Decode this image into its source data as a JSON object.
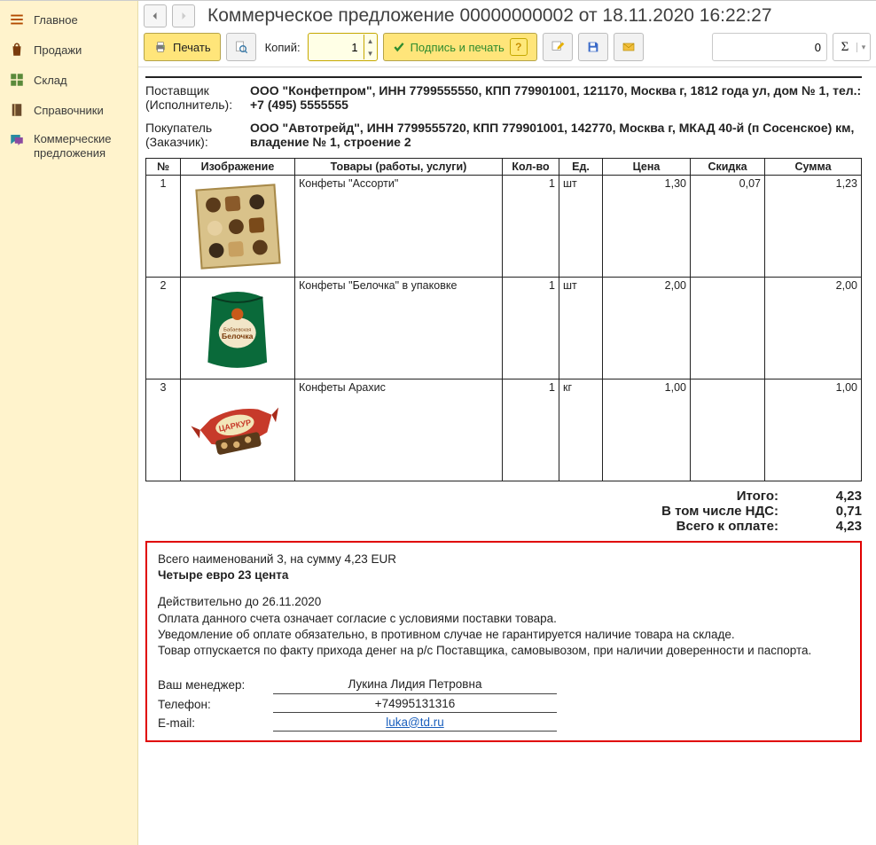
{
  "sidebar": {
    "items": [
      {
        "label": "Главное",
        "icon": "menu-icon"
      },
      {
        "label": "Продажи",
        "icon": "bag-icon"
      },
      {
        "label": "Склад",
        "icon": "grid-icon"
      },
      {
        "label": "Справочники",
        "icon": "book-icon"
      },
      {
        "label": "Коммерческие\nпредложения",
        "icon": "chat-icon"
      }
    ]
  },
  "header": {
    "title": "Коммерческое предложение 00000000002 от 18.11.2020 16:22:27"
  },
  "toolbar": {
    "print": "Печать",
    "copies_label": "Копий:",
    "copies_value": "1",
    "sign_print": "Подпись и печать",
    "num_value": "0"
  },
  "doc": {
    "supplier_label": "Поставщик (Исполнитель):",
    "supplier": "ООО \"Конфетпром\", ИНН 7799555550, КПП 779901001, 121170, Москва г, 1812 года ул, дом № 1, тел.: +7 (495) 5555555",
    "buyer_label": "Покупатель (Заказчик):",
    "buyer": "ООО \"Автотрейд\", ИНН 7799555720, КПП 779901001, 142770, Москва г, МКАД 40-й (п Сосенское) км, владение № 1, строение 2",
    "cols": {
      "num": "№",
      "img": "Изображение",
      "name": "Товары (работы, услуги)",
      "qty": "Кол-во",
      "unit": "Ед.",
      "price": "Цена",
      "disc": "Скидка",
      "sum": "Сумма"
    },
    "rows": [
      {
        "num": "1",
        "name": "Конфеты \"Ассорти\"",
        "qty": "1",
        "unit": "шт",
        "price": "1,30",
        "disc": "0,07",
        "sum": "1,23"
      },
      {
        "num": "2",
        "name": "Конфеты \"Белочка\" в упаковке",
        "qty": "1",
        "unit": "шт",
        "price": "2,00",
        "disc": "",
        "sum": "2,00"
      },
      {
        "num": "3",
        "name": "Конфеты Арахис",
        "qty": "1",
        "unit": "кг",
        "price": "1,00",
        "disc": "",
        "sum": "1,00"
      }
    ],
    "totals": {
      "total_label": "Итого:",
      "total_value": "4,23",
      "vat_label": "В том числе НДС:",
      "vat_value": "0,71",
      "pay_label": "Всего к оплате:",
      "pay_value": "4,23"
    },
    "foot": {
      "count_line": "Всего наименований 3, на сумму 4,23 EUR",
      "words": "Четыре евро 23 цента",
      "valid_line": "Действительно до 26.11.2020",
      "terms1": "Оплата данного счета означает согласие с условиями поставки товара.",
      "terms2": "Уведомление об оплате обязательно, в противном случае не гарантируется наличие товара на складе.",
      "terms3": "Товар отпускается по факту прихода денег на р/с Поставщика, самовывозом, при наличии доверенности и паспорта.",
      "mgr_label": "Ваш менеджер:",
      "mgr_value": "Лукина Лидия Петровна",
      "phone_label": "Телефон:",
      "phone_value": "+74995131316",
      "email_label": "E-mail:",
      "email_value": "luka@td.ru"
    }
  }
}
